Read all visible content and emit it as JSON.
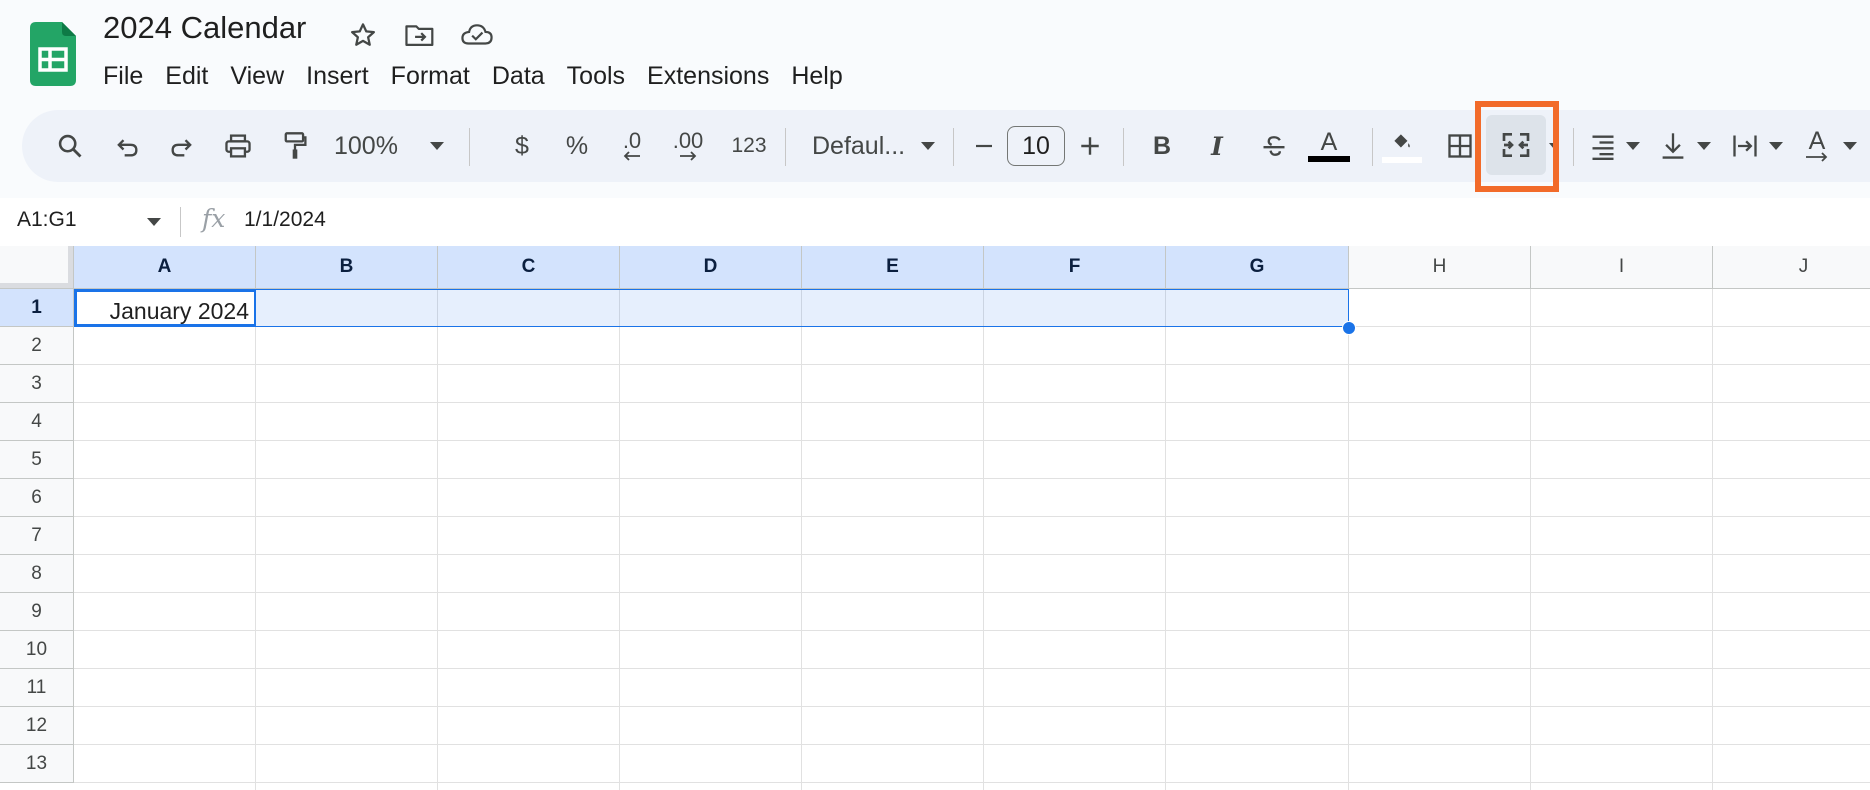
{
  "app": {
    "title": "2024 Calendar",
    "menu": [
      "File",
      "Edit",
      "View",
      "Insert",
      "Format",
      "Data",
      "Tools",
      "Extensions",
      "Help"
    ]
  },
  "toolbar": {
    "zoom": "100%",
    "currency": "$",
    "percent": "%",
    "decrease_decimal": ".0",
    "increase_decimal": ".00",
    "number_format": "123",
    "font": "Defaul...",
    "font_size": "10",
    "bold": "B",
    "italic": "I",
    "text_color_letter": "A",
    "text_rotation_letter": "A",
    "highlight_color": "#f26b2a"
  },
  "formula_bar": {
    "name_box": "A1:G1",
    "fx": "fx",
    "value": "1/1/2024"
  },
  "grid": {
    "columns": [
      "A",
      "B",
      "C",
      "D",
      "E",
      "F",
      "G",
      "H",
      "I",
      "J"
    ],
    "selected_columns": [
      "A",
      "B",
      "C",
      "D",
      "E",
      "F",
      "G"
    ],
    "rows": [
      "1",
      "2",
      "3",
      "4",
      "5",
      "6",
      "7",
      "8",
      "9",
      "10",
      "11",
      "12",
      "13"
    ],
    "selected_row": "1",
    "selection": "A1:G1",
    "cells": {
      "A1": "January 2024"
    }
  },
  "colors": {
    "selection_blue": "#1a73e8",
    "header_selected_bg": "#d3e3fd",
    "sheets_green": "#23a566"
  }
}
